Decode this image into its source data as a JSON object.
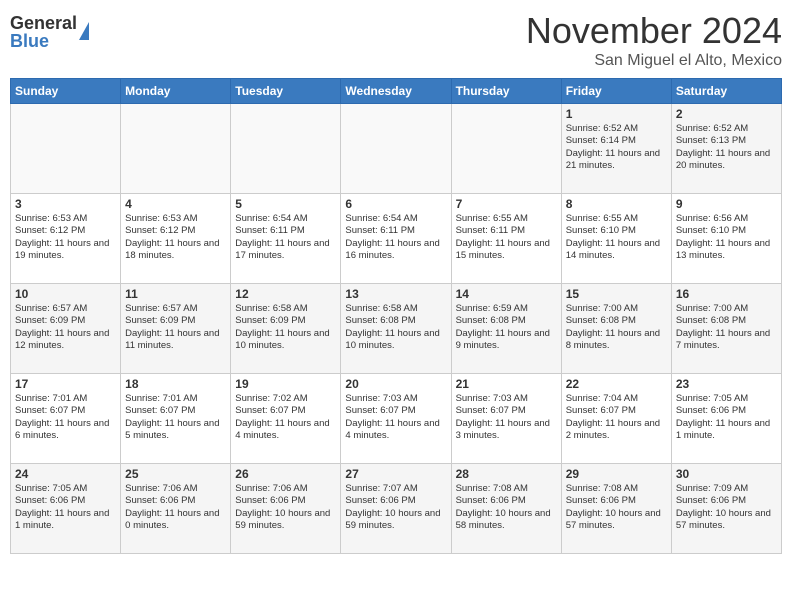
{
  "header": {
    "logo": {
      "general": "General",
      "blue": "Blue"
    },
    "title": "November 2024",
    "location": "San Miguel el Alto, Mexico"
  },
  "calendar": {
    "days_of_week": [
      "Sunday",
      "Monday",
      "Tuesday",
      "Wednesday",
      "Thursday",
      "Friday",
      "Saturday"
    ],
    "weeks": [
      [
        {
          "day": "",
          "info": ""
        },
        {
          "day": "",
          "info": ""
        },
        {
          "day": "",
          "info": ""
        },
        {
          "day": "",
          "info": ""
        },
        {
          "day": "",
          "info": ""
        },
        {
          "day": "1",
          "info": "Sunrise: 6:52 AM\nSunset: 6:14 PM\nDaylight: 11 hours and 21 minutes."
        },
        {
          "day": "2",
          "info": "Sunrise: 6:52 AM\nSunset: 6:13 PM\nDaylight: 11 hours and 20 minutes."
        }
      ],
      [
        {
          "day": "3",
          "info": "Sunrise: 6:53 AM\nSunset: 6:12 PM\nDaylight: 11 hours and 19 minutes."
        },
        {
          "day": "4",
          "info": "Sunrise: 6:53 AM\nSunset: 6:12 PM\nDaylight: 11 hours and 18 minutes."
        },
        {
          "day": "5",
          "info": "Sunrise: 6:54 AM\nSunset: 6:11 PM\nDaylight: 11 hours and 17 minutes."
        },
        {
          "day": "6",
          "info": "Sunrise: 6:54 AM\nSunset: 6:11 PM\nDaylight: 11 hours and 16 minutes."
        },
        {
          "day": "7",
          "info": "Sunrise: 6:55 AM\nSunset: 6:11 PM\nDaylight: 11 hours and 15 minutes."
        },
        {
          "day": "8",
          "info": "Sunrise: 6:55 AM\nSunset: 6:10 PM\nDaylight: 11 hours and 14 minutes."
        },
        {
          "day": "9",
          "info": "Sunrise: 6:56 AM\nSunset: 6:10 PM\nDaylight: 11 hours and 13 minutes."
        }
      ],
      [
        {
          "day": "10",
          "info": "Sunrise: 6:57 AM\nSunset: 6:09 PM\nDaylight: 11 hours and 12 minutes."
        },
        {
          "day": "11",
          "info": "Sunrise: 6:57 AM\nSunset: 6:09 PM\nDaylight: 11 hours and 11 minutes."
        },
        {
          "day": "12",
          "info": "Sunrise: 6:58 AM\nSunset: 6:09 PM\nDaylight: 11 hours and 10 minutes."
        },
        {
          "day": "13",
          "info": "Sunrise: 6:58 AM\nSunset: 6:08 PM\nDaylight: 11 hours and 10 minutes."
        },
        {
          "day": "14",
          "info": "Sunrise: 6:59 AM\nSunset: 6:08 PM\nDaylight: 11 hours and 9 minutes."
        },
        {
          "day": "15",
          "info": "Sunrise: 7:00 AM\nSunset: 6:08 PM\nDaylight: 11 hours and 8 minutes."
        },
        {
          "day": "16",
          "info": "Sunrise: 7:00 AM\nSunset: 6:08 PM\nDaylight: 11 hours and 7 minutes."
        }
      ],
      [
        {
          "day": "17",
          "info": "Sunrise: 7:01 AM\nSunset: 6:07 PM\nDaylight: 11 hours and 6 minutes."
        },
        {
          "day": "18",
          "info": "Sunrise: 7:01 AM\nSunset: 6:07 PM\nDaylight: 11 hours and 5 minutes."
        },
        {
          "day": "19",
          "info": "Sunrise: 7:02 AM\nSunset: 6:07 PM\nDaylight: 11 hours and 4 minutes."
        },
        {
          "day": "20",
          "info": "Sunrise: 7:03 AM\nSunset: 6:07 PM\nDaylight: 11 hours and 4 minutes."
        },
        {
          "day": "21",
          "info": "Sunrise: 7:03 AM\nSunset: 6:07 PM\nDaylight: 11 hours and 3 minutes."
        },
        {
          "day": "22",
          "info": "Sunrise: 7:04 AM\nSunset: 6:07 PM\nDaylight: 11 hours and 2 minutes."
        },
        {
          "day": "23",
          "info": "Sunrise: 7:05 AM\nSunset: 6:06 PM\nDaylight: 11 hours and 1 minute."
        }
      ],
      [
        {
          "day": "24",
          "info": "Sunrise: 7:05 AM\nSunset: 6:06 PM\nDaylight: 11 hours and 1 minute."
        },
        {
          "day": "25",
          "info": "Sunrise: 7:06 AM\nSunset: 6:06 PM\nDaylight: 11 hours and 0 minutes."
        },
        {
          "day": "26",
          "info": "Sunrise: 7:06 AM\nSunset: 6:06 PM\nDaylight: 10 hours and 59 minutes."
        },
        {
          "day": "27",
          "info": "Sunrise: 7:07 AM\nSunset: 6:06 PM\nDaylight: 10 hours and 59 minutes."
        },
        {
          "day": "28",
          "info": "Sunrise: 7:08 AM\nSunset: 6:06 PM\nDaylight: 10 hours and 58 minutes."
        },
        {
          "day": "29",
          "info": "Sunrise: 7:08 AM\nSunset: 6:06 PM\nDaylight: 10 hours and 57 minutes."
        },
        {
          "day": "30",
          "info": "Sunrise: 7:09 AM\nSunset: 6:06 PM\nDaylight: 10 hours and 57 minutes."
        }
      ]
    ]
  }
}
